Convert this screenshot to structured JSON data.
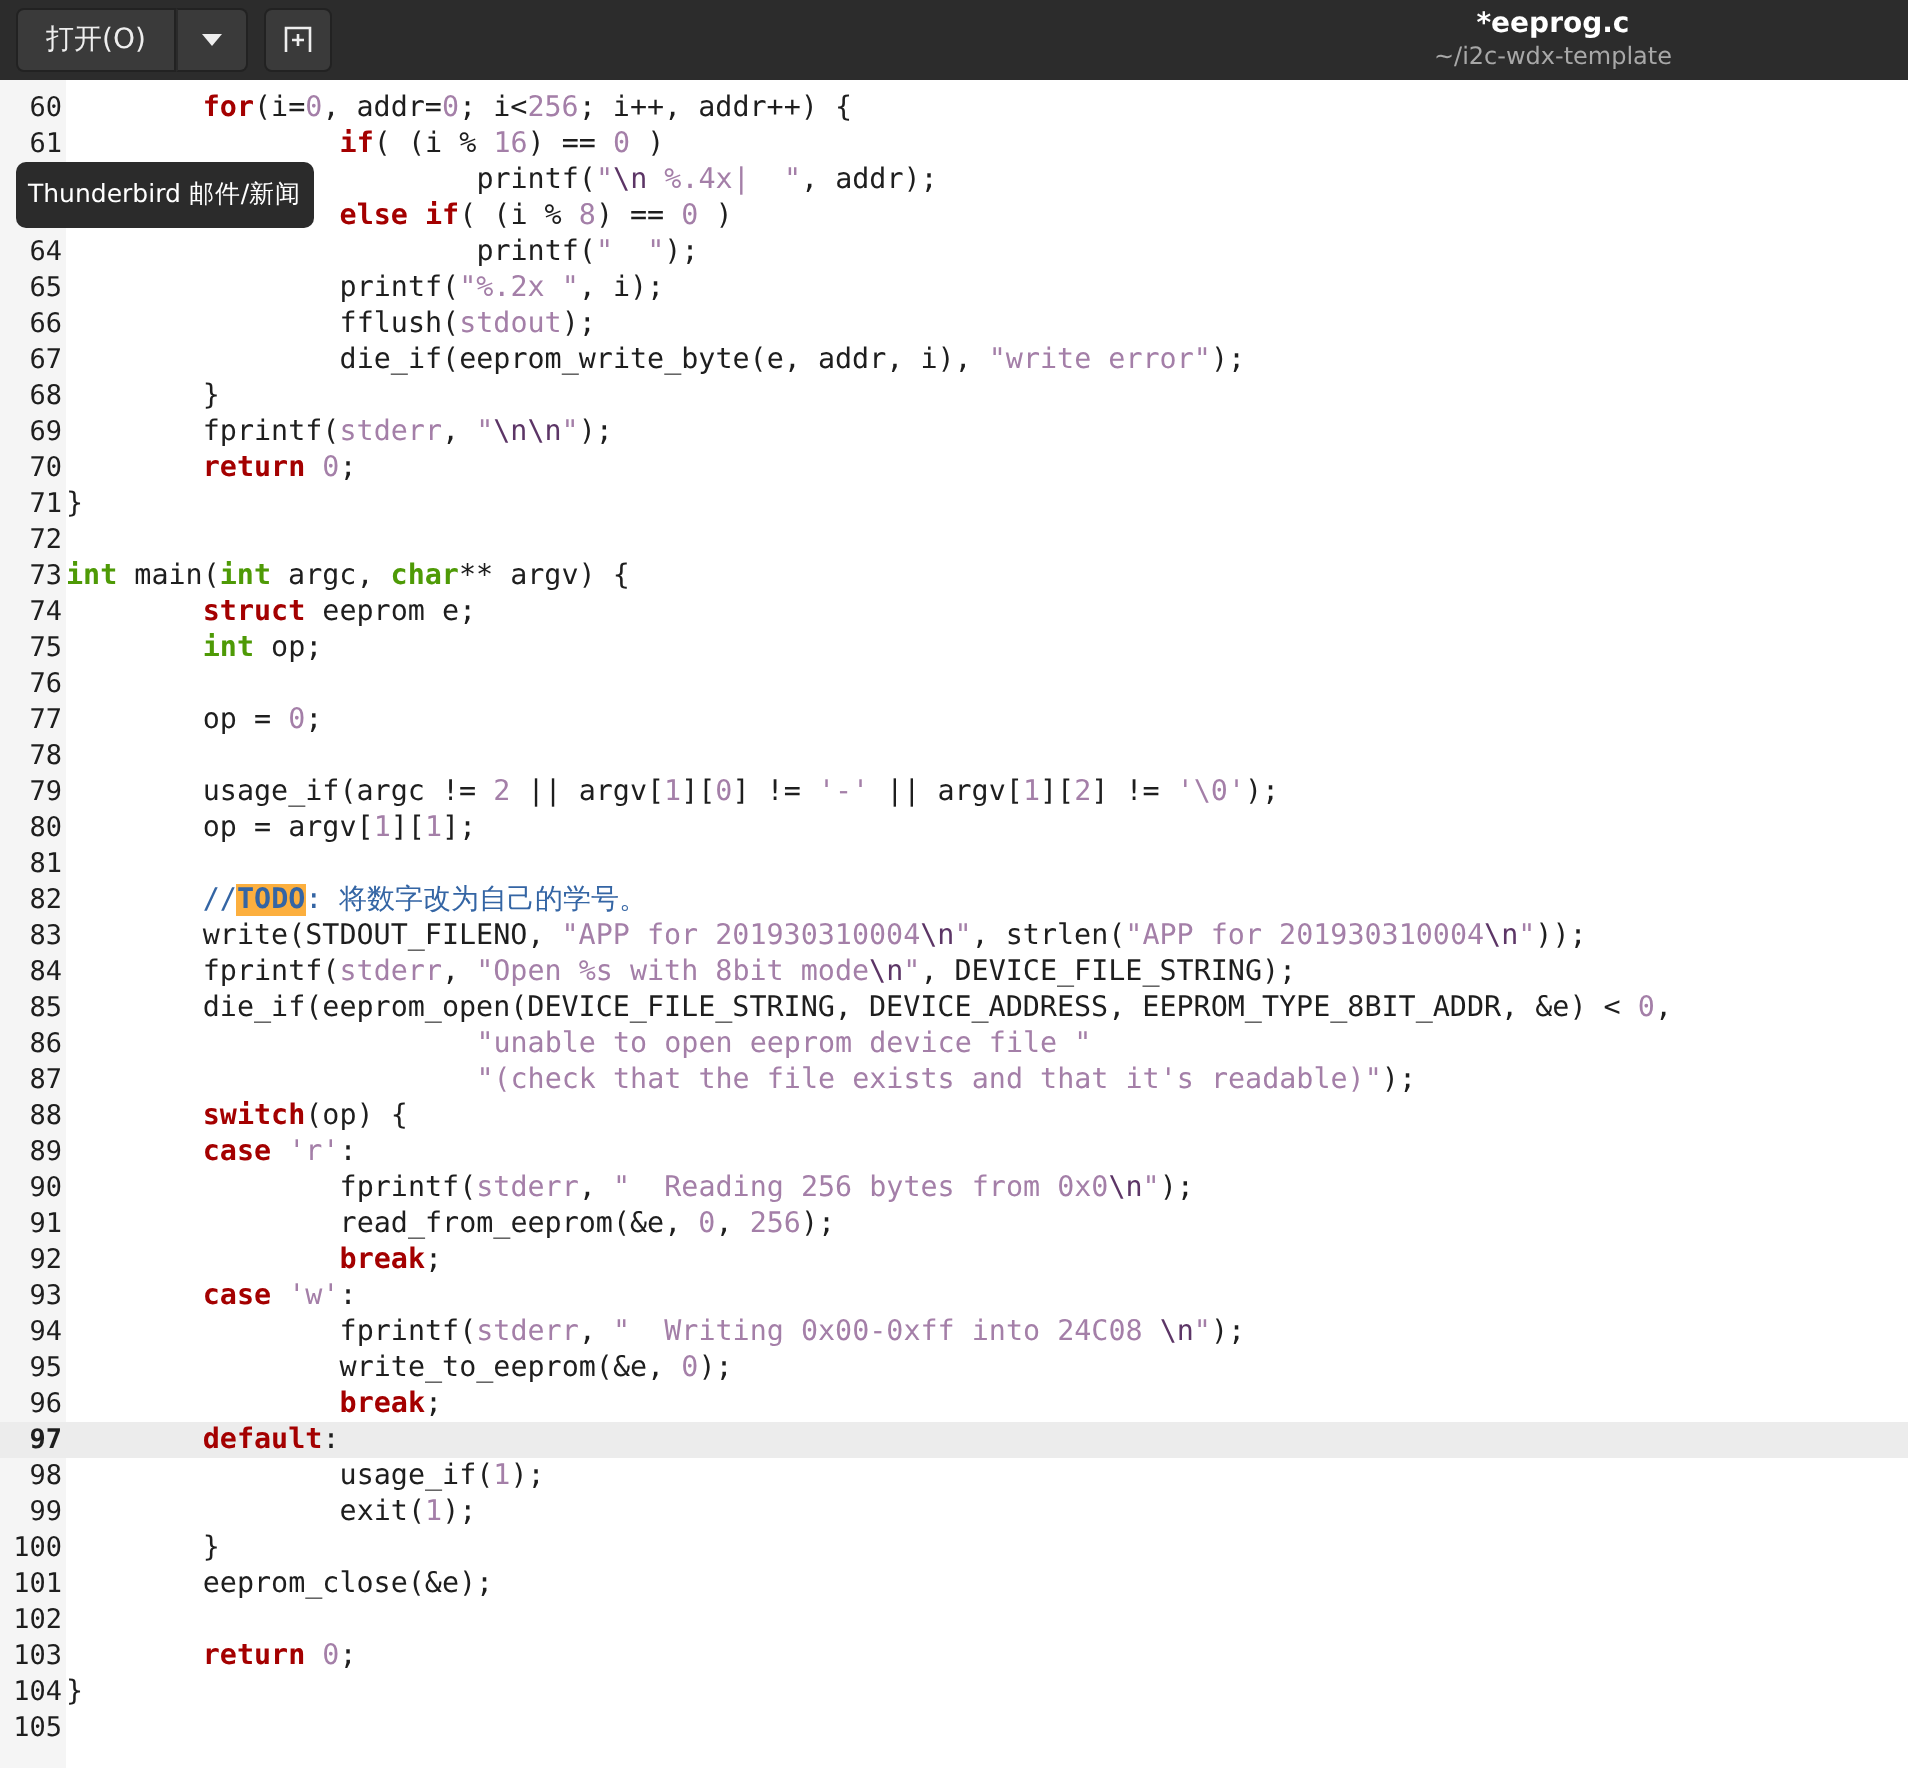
{
  "header": {
    "open_button": "打开(O)",
    "title": "*eeprog.c",
    "subtitle": "~/i2c-wdx-template"
  },
  "tooltip": "Thunderbird 邮件/新闻",
  "lines": [
    {
      "number": "60",
      "current": false,
      "kind": "body",
      "tokens": [
        {
          "kind": "keyword",
          "text": "for"
        },
        "(i=",
        {
          "kind": "literal",
          "text": "0"
        },
        ", addr=",
        {
          "kind": "literal",
          "text": "0"
        },
        "; i<",
        {
          "kind": "literal",
          "text": "256"
        },
        "; i++, addr++) {"
      ]
    },
    {
      "number": "61",
      "current": false,
      "kind": "inner",
      "tokens": [
        {
          "kind": "keyword",
          "text": "if"
        },
        "( (i % ",
        {
          "kind": "literal",
          "text": "16"
        },
        ") == ",
        {
          "kind": "literal",
          "text": "0"
        },
        " )"
      ]
    },
    {
      "current": false,
      "kind": "innermost",
      "tokens": [
        "printf(",
        {
          "kind": "literal",
          "text": "\""
        },
        {
          "kind": "escape",
          "text": "\\n"
        },
        {
          "kind": "literal",
          "text": " %.4x|  \""
        },
        ", addr);"
      ]
    },
    {
      "current": false,
      "kind": "inner",
      "tokens": [
        {
          "kind": "keyword",
          "text": "else if"
        },
        "( (i % ",
        {
          "kind": "literal",
          "text": "8"
        },
        ") == ",
        {
          "kind": "literal",
          "text": "0"
        },
        " )"
      ]
    },
    {
      "number": "64",
      "current": false,
      "kind": "innermost",
      "tokens": [
        "printf(",
        {
          "kind": "literal",
          "text": "\"  \""
        },
        ");"
      ]
    },
    {
      "number": "65",
      "current": false,
      "kind": "inner",
      "tokens": [
        "printf(",
        {
          "kind": "literal",
          "text": "\"%.2x \""
        },
        ", i);"
      ]
    },
    {
      "number": "66",
      "current": false,
      "kind": "inner",
      "tokens": [
        "fflush(",
        {
          "kind": "literal",
          "text": "stdout"
        },
        ");"
      ]
    },
    {
      "number": "67",
      "current": false,
      "kind": "inner",
      "tokens": [
        "die_if(eeprom_write_byte(e, addr, i), ",
        {
          "kind": "literal",
          "text": "\"write error\""
        },
        ");"
      ]
    },
    {
      "number": "68",
      "current": false,
      "kind": "body",
      "tokens": [
        "}"
      ]
    },
    {
      "number": "69",
      "current": false,
      "kind": "body",
      "tokens": [
        "fprintf(",
        {
          "kind": "literal",
          "text": "stderr"
        },
        ", ",
        {
          "kind": "literal",
          "text": "\""
        },
        {
          "kind": "escape",
          "text": "\\n\\n"
        },
        {
          "kind": "literal",
          "text": "\""
        },
        ");"
      ]
    },
    {
      "number": "70",
      "current": false,
      "kind": "body",
      "tokens": [
        {
          "kind": "keyword",
          "text": "return"
        },
        {
          "kind": "literal",
          "text": " 0"
        },
        ";"
      ]
    },
    {
      "number": "71",
      "current": false,
      "kind": "top",
      "tokens": [
        "}"
      ]
    },
    {
      "number": "72",
      "current": false
    },
    {
      "number": "73",
      "current": false,
      "kind": "top",
      "tokens": [
        {
          "kind": "type",
          "text": "int"
        },
        " main(",
        {
          "kind": "type",
          "text": "int"
        },
        " argc, ",
        {
          "kind": "type",
          "text": "char"
        },
        "** argv) {"
      ]
    },
    {
      "number": "74",
      "current": false,
      "kind": "body",
      "tokens": [
        {
          "kind": "keyword",
          "text": "struct"
        },
        " eeprom e;"
      ]
    },
    {
      "number": "75",
      "current": false,
      "kind": "body",
      "tokens": [
        {
          "kind": "type",
          "text": "int"
        },
        " op;"
      ]
    },
    {
      "number": "76",
      "current": false
    },
    {
      "number": "77",
      "current": false,
      "kind": "body",
      "tokens": [
        "op = ",
        {
          "kind": "literal",
          "text": "0"
        },
        ";"
      ]
    },
    {
      "number": "78",
      "current": false
    },
    {
      "number": "79",
      "current": false,
      "kind": "body",
      "tokens": [
        "usage_if(argc != ",
        {
          "kind": "literal",
          "text": "2"
        },
        " || argv[",
        {
          "kind": "literal",
          "text": "1"
        },
        "][",
        {
          "kind": "literal",
          "text": "0"
        },
        "] != ",
        {
          "kind": "literal",
          "text": "'-'"
        },
        " || argv[",
        {
          "kind": "literal",
          "text": "1"
        },
        "][",
        {
          "kind": "literal",
          "text": "2"
        },
        "] != ",
        {
          "kind": "literal",
          "text": "'\\0'"
        },
        ");"
      ]
    },
    {
      "number": "80",
      "current": false,
      "kind": "body",
      "tokens": [
        "op = argv[",
        {
          "kind": "literal",
          "text": "1"
        },
        "][",
        {
          "kind": "literal",
          "text": "1"
        },
        "];"
      ]
    },
    {
      "number": "81",
      "current": false
    },
    {
      "number": "82",
      "current": false,
      "kind": "body",
      "tokens": [
        {
          "kind": "comment",
          "text": "//"
        },
        {
          "kind": "todo",
          "text": "TODO"
        },
        {
          "kind": "comment",
          "text": ": 将数字改为自己的学号。"
        }
      ]
    },
    {
      "number": "83",
      "current": false,
      "kind": "body",
      "tokens": [
        "write(STDOUT_FILENO, ",
        {
          "kind": "literal",
          "text": "\"APP for 201930310004"
        },
        {
          "kind": "escape",
          "text": "\\n"
        },
        {
          "kind": "literal",
          "text": "\""
        },
        ", strlen(",
        {
          "kind": "literal",
          "text": "\"APP for 201930310004"
        },
        {
          "kind": "escape",
          "text": "\\n"
        },
        {
          "kind": "literal",
          "text": "\""
        },
        "));"
      ]
    },
    {
      "number": "84",
      "current": false,
      "kind": "body",
      "tokens": [
        "fprintf(",
        {
          "kind": "literal",
          "text": "stderr"
        },
        ", ",
        {
          "kind": "literal",
          "text": "\"Open %s with 8bit mode"
        },
        {
          "kind": "escape",
          "text": "\\n"
        },
        {
          "kind": "literal",
          "text": "\""
        },
        ", DEVICE_FILE_STRING);"
      ]
    },
    {
      "number": "85",
      "current": false,
      "kind": "body",
      "tokens": [
        "die_if(eeprom_open(DEVICE_FILE_STRING, DEVICE_ADDRESS, EEPROM_TYPE_8BIT_ADDR, &e) < ",
        {
          "kind": "literal",
          "text": "0"
        },
        ","
      ]
    },
    {
      "number": "86",
      "current": false,
      "kind": "innermost",
      "tokens": [
        {
          "kind": "literal",
          "text": "\"unable to open eeprom device file \""
        }
      ]
    },
    {
      "number": "87",
      "current": false,
      "kind": "innermost",
      "tokens": [
        {
          "kind": "literal",
          "text": "\"(check that the file exists and that it's readable)\""
        },
        ");"
      ]
    },
    {
      "number": "88",
      "current": false,
      "kind": "body",
      "tokens": [
        {
          "kind": "keyword",
          "text": "switch"
        },
        "(op) {"
      ]
    },
    {
      "number": "89",
      "current": false,
      "kind": "body",
      "tokens": [
        {
          "kind": "keyword",
          "text": "case"
        },
        {
          "kind": "literal",
          "text": " 'r'"
        },
        ":"
      ]
    },
    {
      "number": "90",
      "current": false,
      "kind": "inner",
      "tokens": [
        "fprintf(",
        {
          "kind": "literal",
          "text": "stderr"
        },
        ", ",
        {
          "kind": "literal",
          "text": "\"  Reading 256 bytes from 0x0"
        },
        {
          "kind": "escape",
          "text": "\\n"
        },
        {
          "kind": "literal",
          "text": "\""
        },
        ");"
      ]
    },
    {
      "number": "91",
      "current": false,
      "kind": "inner",
      "tokens": [
        "read_from_eeprom(&e, ",
        {
          "kind": "literal",
          "text": "0"
        },
        ", ",
        {
          "kind": "literal",
          "text": "256"
        },
        ");"
      ]
    },
    {
      "number": "92",
      "current": false,
      "kind": "inner",
      "tokens": [
        {
          "kind": "keyword",
          "text": "break"
        },
        ";"
      ]
    },
    {
      "number": "93",
      "current": false,
      "kind": "body",
      "tokens": [
        {
          "kind": "keyword",
          "text": "case"
        },
        {
          "kind": "literal",
          "text": " 'w'"
        },
        ":"
      ]
    },
    {
      "number": "94",
      "current": false,
      "kind": "inner",
      "tokens": [
        "fprintf(",
        {
          "kind": "literal",
          "text": "stderr"
        },
        ", ",
        {
          "kind": "literal",
          "text": "\"  Writing 0x00-0xff into 24C08 "
        },
        {
          "kind": "escape",
          "text": "\\n"
        },
        {
          "kind": "literal",
          "text": "\""
        },
        ");"
      ]
    },
    {
      "number": "95",
      "current": false,
      "kind": "inner",
      "tokens": [
        "write_to_eeprom(&e, ",
        {
          "kind": "literal",
          "text": "0"
        },
        ");"
      ]
    },
    {
      "number": "96",
      "current": false,
      "kind": "inner",
      "tokens": [
        {
          "kind": "keyword",
          "text": "break"
        },
        ";"
      ]
    },
    {
      "number": "97",
      "current": true,
      "kind": "body",
      "tokens": [
        {
          "kind": "keyword",
          "text": "default"
        },
        ":"
      ]
    },
    {
      "number": "98",
      "current": false,
      "kind": "inner",
      "tokens": [
        "usage_if(",
        {
          "kind": "literal",
          "text": "1"
        },
        ");"
      ]
    },
    {
      "number": "99",
      "current": false,
      "kind": "inner",
      "tokens": [
        "exit(",
        {
          "kind": "literal",
          "text": "1"
        },
        ");"
      ]
    },
    {
      "number": "100",
      "current": false,
      "kind": "body",
      "tokens": [
        "}"
      ]
    },
    {
      "number": "101",
      "current": false,
      "kind": "body",
      "tokens": [
        "eeprom_close(&e);"
      ]
    },
    {
      "number": "102",
      "current": false
    },
    {
      "number": "103",
      "current": false,
      "kind": "body",
      "tokens": [
        {
          "kind": "keyword",
          "text": "return"
        },
        {
          "kind": "literal",
          "text": " 0"
        },
        ";"
      ]
    },
    {
      "number": "104",
      "current": false,
      "kind": "top",
      "tokens": [
        "}"
      ]
    },
    {
      "number": "105",
      "current": false
    }
  ]
}
